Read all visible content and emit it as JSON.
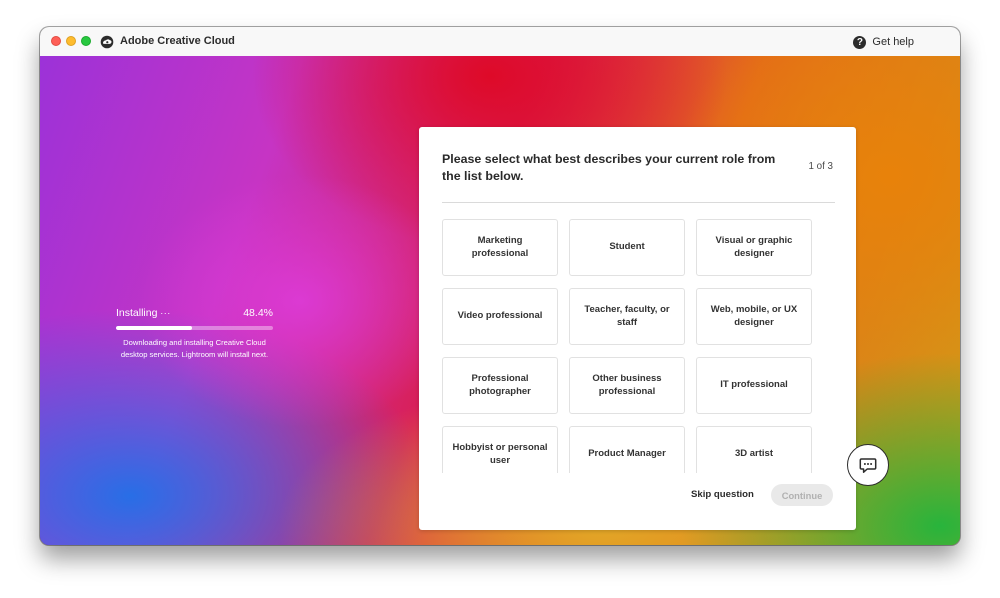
{
  "window": {
    "title": "Adobe Creative Cloud",
    "help_label": "Get help",
    "help_icon_glyph": "?"
  },
  "installer": {
    "status_label": "Installing",
    "status_dots": "...",
    "percent_label": "48.4%",
    "progress_fraction": 0.484,
    "description_line1": "Downloading and installing Creative Cloud",
    "description_line2": "desktop services. Lightroom will install next."
  },
  "survey": {
    "question": "Please select what best describes your current role from the list below.",
    "step": "1 of 3",
    "options": [
      "Marketing professional",
      "Student",
      "Visual or graphic designer",
      "Video professional",
      "Teacher, faculty, or staff",
      "Web, mobile, or UX designer",
      "Professional photographer",
      "Other business professional",
      "IT professional",
      "Hobbyist or personal user",
      "Product Manager",
      "3D artist"
    ],
    "skip_label": "Skip question",
    "continue_label": "Continue"
  },
  "icons": {
    "app_logo": "creative-cloud-logo",
    "help": "help-circle-icon",
    "chat": "chat-bubble-icon"
  },
  "colors": {
    "close": "#fe5f57",
    "minimize": "#febc2e",
    "maximize": "#28c840",
    "continue_disabled_bg": "#e9e9e9",
    "continue_disabled_text": "#b1b1b1"
  }
}
